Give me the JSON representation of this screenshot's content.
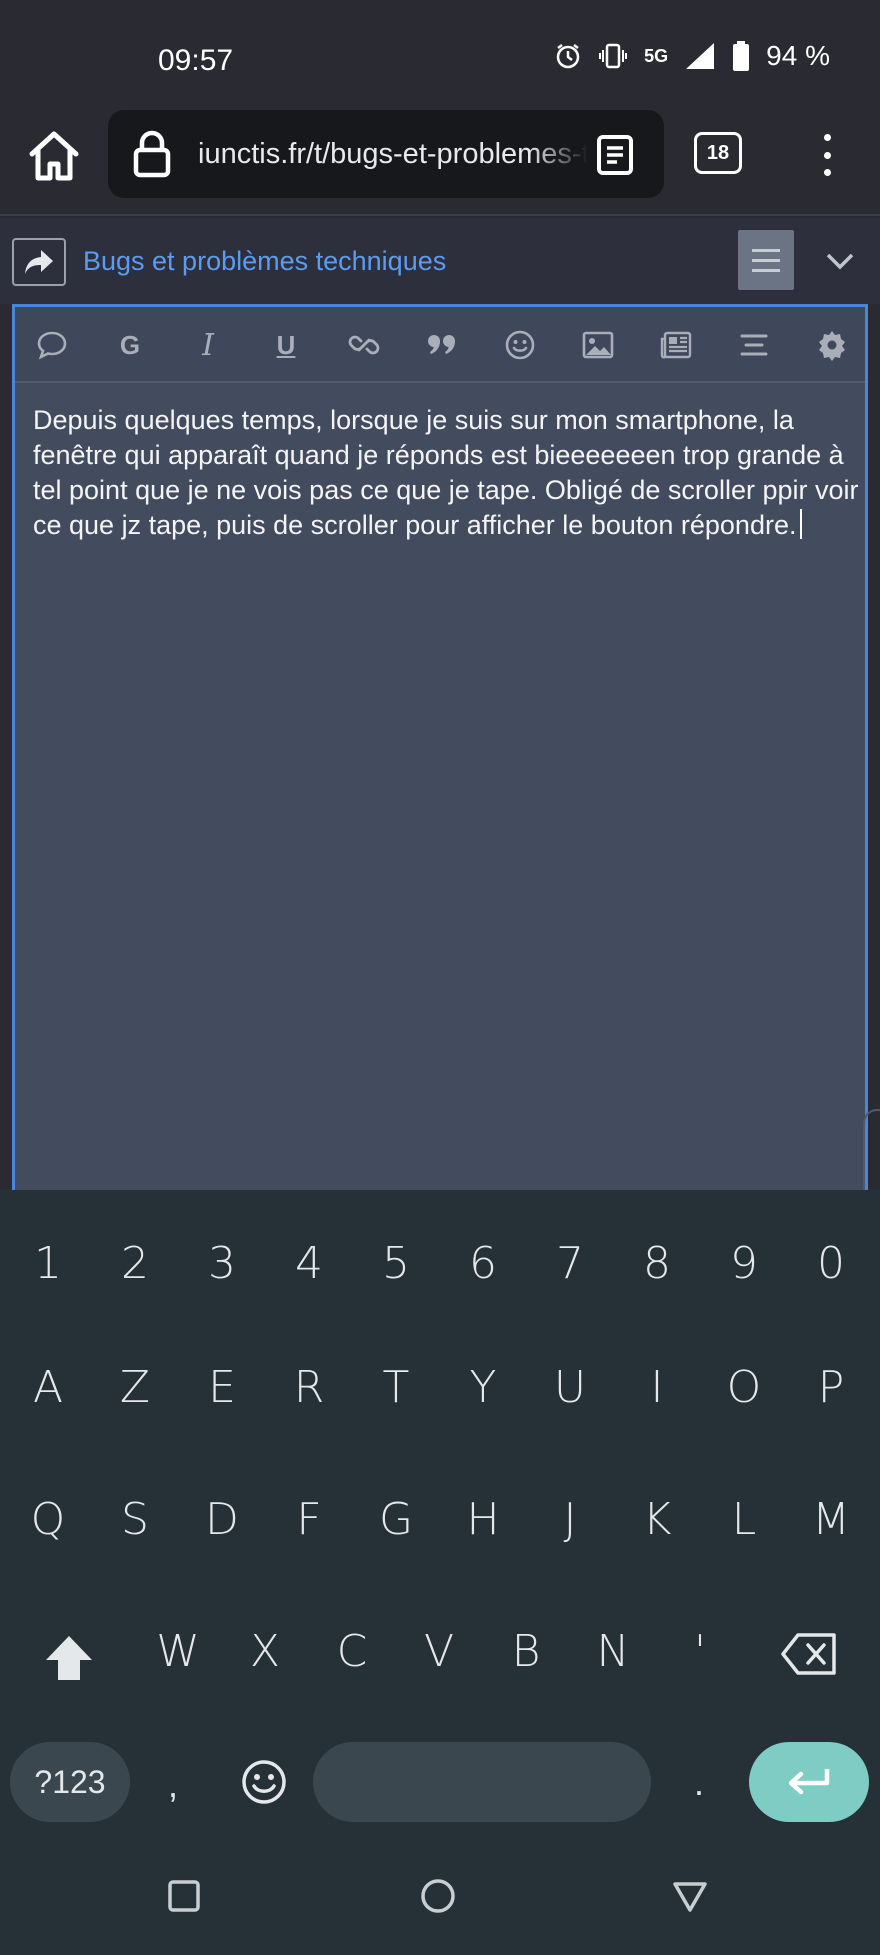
{
  "status_bar": {
    "time": "09:57",
    "network": "5G",
    "battery": "94 %",
    "icons": [
      "alarm-icon",
      "vibrate-icon",
      "network-5g-icon",
      "signal-icon",
      "battery-icon"
    ]
  },
  "browser": {
    "url": "iunctis.fr/t/bugs-et-problemes-techniques",
    "tab_count": "18",
    "icons": [
      "home-icon",
      "lock-icon",
      "reader-mode-icon",
      "tabs-icon",
      "more-vert-icon"
    ]
  },
  "composer": {
    "topic_title": "Bugs et problèmes techniques",
    "body_text": "Depuis quelques temps, lorsque je suis sur mon smartphone, la fenêtre qui apparaît quand je réponds est bieeeeeeen trop grande à tel point que je ne vois pas ce que je tape. Obligé de scroller ppir voir ce que jz tape, puis de scroller pour afficher le bouton répondre.",
    "toolbar": [
      "quote-icon",
      "bold-icon",
      "italic-icon",
      "underline-icon",
      "link-icon",
      "blockquote-icon",
      "emoji-icon",
      "image-icon",
      "preformatted-icon",
      "align-icon",
      "settings-icon"
    ],
    "bold_label": "G",
    "italic_label": "I",
    "underline_label": "U",
    "accent_color": "#4a86d8",
    "link_color": "#5b9cf0"
  },
  "keyboard": {
    "row_numbers": [
      "1",
      "2",
      "3",
      "4",
      "5",
      "6",
      "7",
      "8",
      "9",
      "0"
    ],
    "row_1": [
      "A",
      "Z",
      "E",
      "R",
      "T",
      "Y",
      "U",
      "I",
      "O",
      "P"
    ],
    "row_2": [
      "Q",
      "S",
      "D",
      "F",
      "G",
      "H",
      "J",
      "K",
      "L",
      "M"
    ],
    "row_3": [
      "W",
      "X",
      "C",
      "V",
      "B",
      "N",
      "'"
    ],
    "symbols_label": "?123",
    "comma": ",",
    "period": ".",
    "enter_color": "#7fccc4"
  },
  "navigation": [
    "recents-icon",
    "home-nav-icon",
    "back-icon"
  ]
}
